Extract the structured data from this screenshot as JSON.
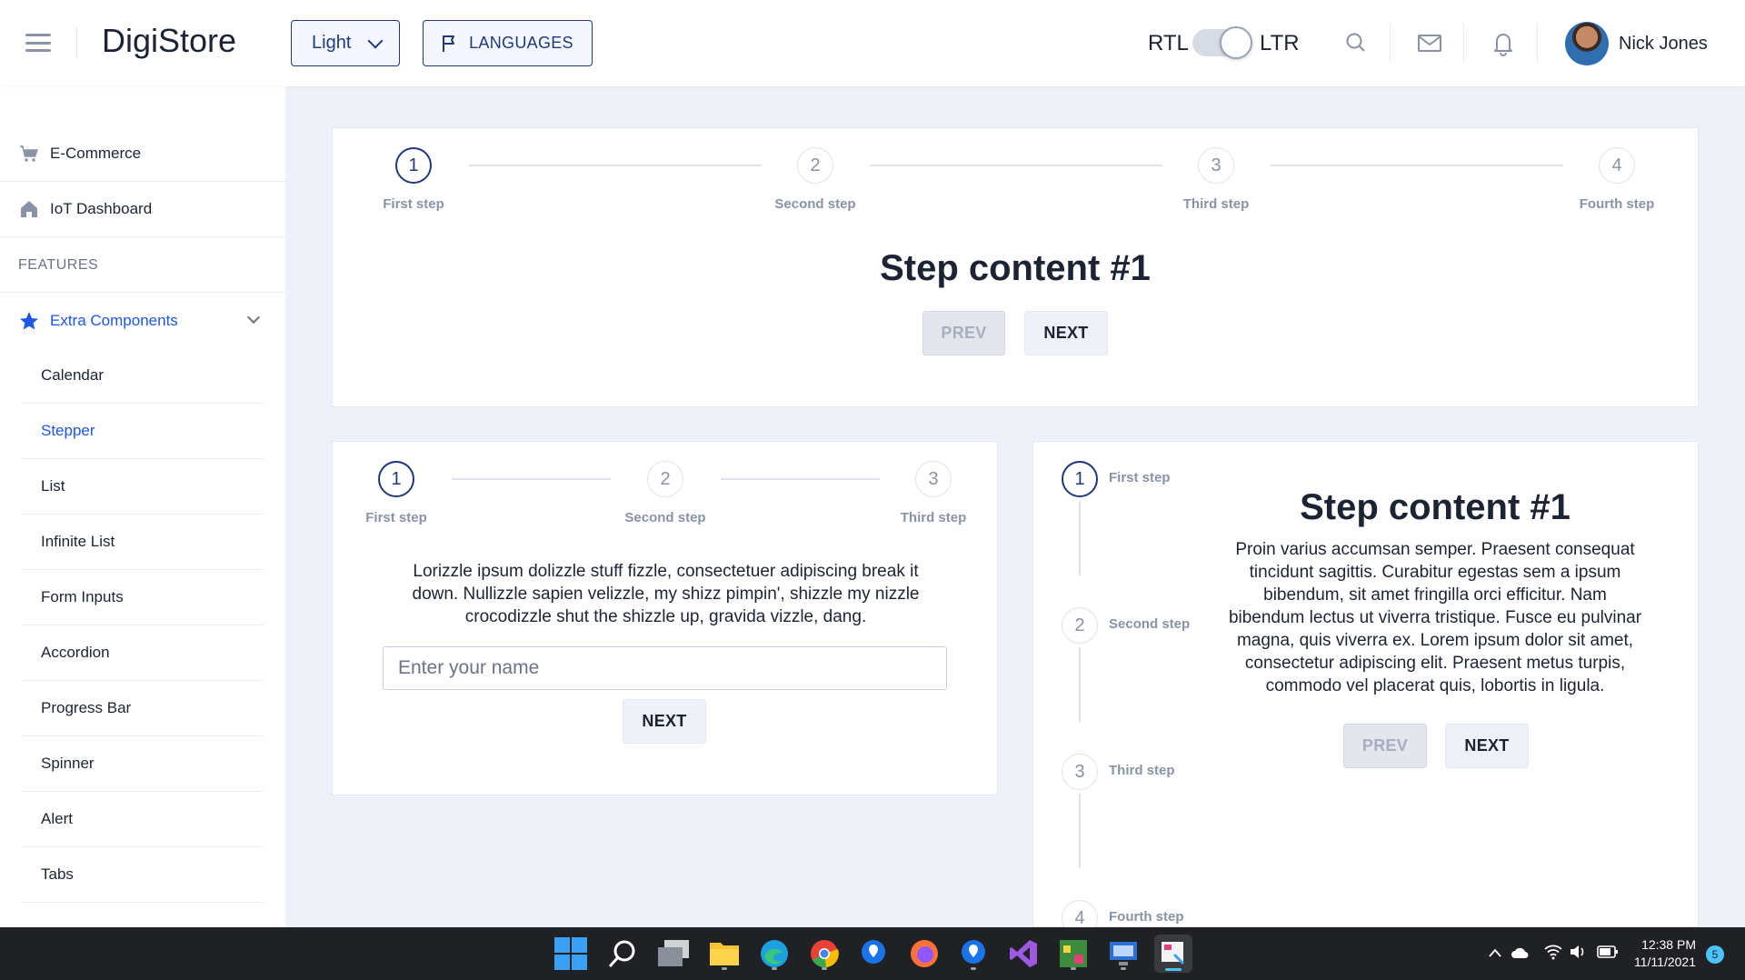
{
  "header": {
    "brand": "DigiStore",
    "theme_value": "Light",
    "languages_label": "LANGUAGES",
    "rtl_label": "RTL",
    "ltr_label": "LTR",
    "user_name": "Nick Jones"
  },
  "sidebar": {
    "items": [
      {
        "label": "E-Commerce",
        "icon": "cart-icon"
      },
      {
        "label": "IoT Dashboard",
        "icon": "home-icon"
      }
    ],
    "section_label": "FEATURES",
    "group": {
      "label": "Extra Components",
      "icon": "star-icon"
    },
    "subitems": [
      "Calendar",
      "Stepper",
      "List",
      "Infinite List",
      "Form Inputs",
      "Accordion",
      "Progress Bar",
      "Spinner",
      "Alert",
      "Tabs"
    ],
    "active_subitem": "Stepper"
  },
  "stepper_horizontal": {
    "steps": [
      {
        "num": "1",
        "label": "First step"
      },
      {
        "num": "2",
        "label": "Second step"
      },
      {
        "num": "3",
        "label": "Third step"
      },
      {
        "num": "4",
        "label": "Fourth step"
      }
    ],
    "active_step": 1,
    "content_title": "Step content #1",
    "prev_label": "PREV",
    "next_label": "NEXT"
  },
  "stepper_form": {
    "steps": [
      {
        "num": "1",
        "label": "First step"
      },
      {
        "num": "2",
        "label": "Second step"
      },
      {
        "num": "3",
        "label": "Third step"
      }
    ],
    "active_step": 1,
    "paragraph": "Lorizzle ipsum dolizzle stuff fizzle, consectetuer adipiscing break it down. Nullizzle sapien velizzle, my shizz pimpin', shizzle my nizzle crocodizzle shut the shizzle up, gravida vizzle, dang.",
    "input_placeholder": "Enter your name",
    "input_value": "",
    "next_label": "NEXT"
  },
  "stepper_vertical": {
    "steps": [
      {
        "num": "1",
        "label": "First step"
      },
      {
        "num": "2",
        "label": "Second step"
      },
      {
        "num": "3",
        "label": "Third step"
      },
      {
        "num": "4",
        "label": "Fourth step"
      }
    ],
    "active_step": 1,
    "content_title": "Step content #1",
    "paragraph": "Proin varius accumsan semper. Praesent consequat tincidunt sagittis. Curabitur egestas sem a ipsum bibendum, sit amet fringilla orci efficitur. Nam bibendum lectus ut viverra tristique. Fusce eu pulvinar magna, quis viverra ex. Lorem ipsum dolor sit amet, consectetur adipiscing elit. Praesent metus turpis, commodo vel placerat quis, lobortis in ligula.",
    "prev_label": "PREV",
    "next_label": "NEXT"
  },
  "taskbar": {
    "time": "12:38 PM",
    "date": "11/11/2021",
    "notification_count": "5"
  },
  "colors": {
    "accent": "#1c57e6",
    "primary_dark": "#1f3a78",
    "background": "#eef1f7"
  }
}
